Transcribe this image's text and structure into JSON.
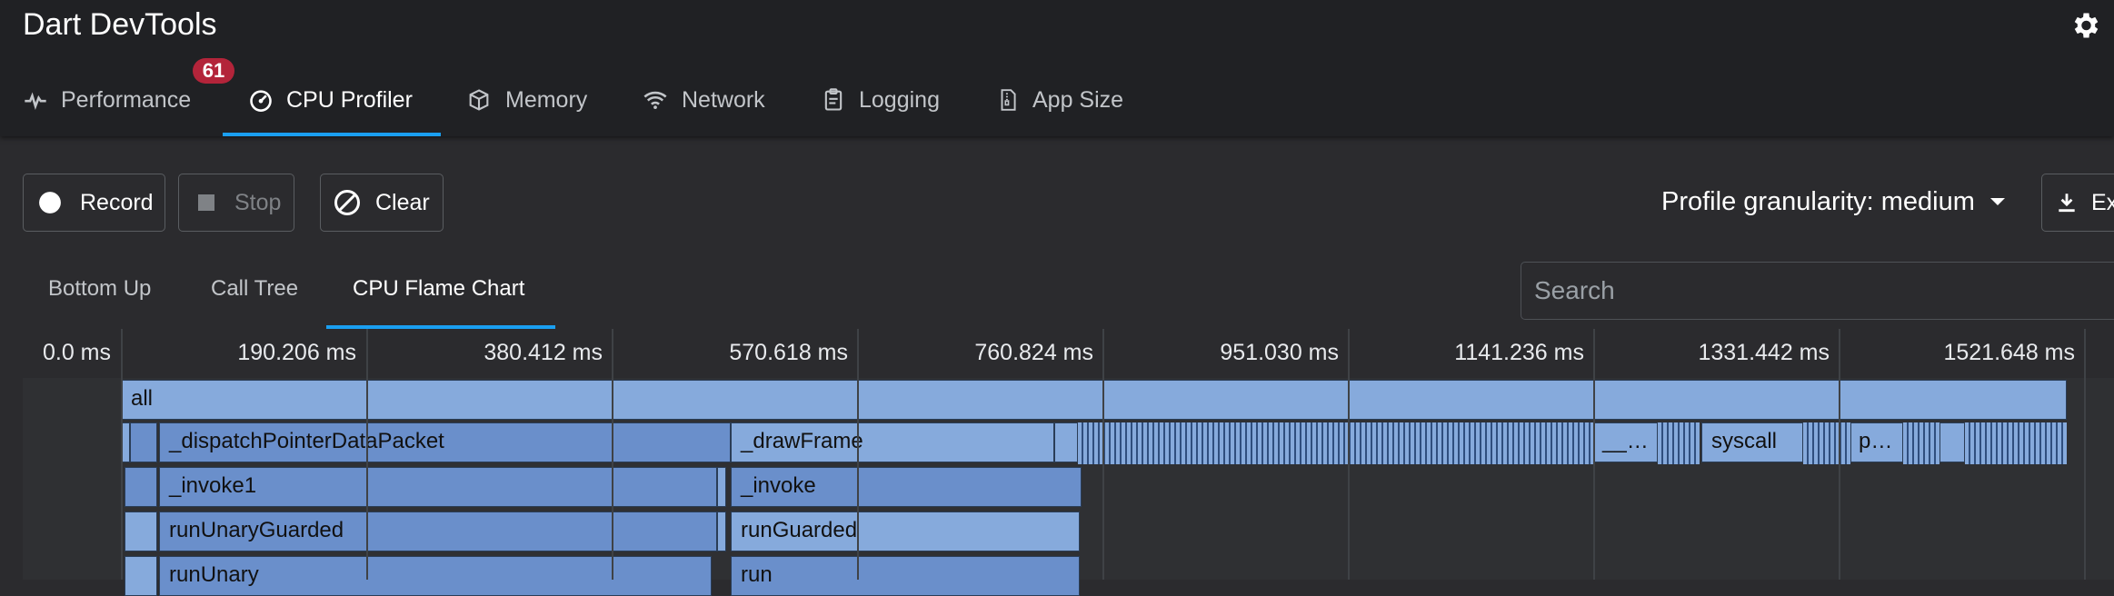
{
  "app": {
    "title": "Dart DevTools"
  },
  "settings": {
    "icon": "gear-icon"
  },
  "tabs": [
    {
      "label": "Performance",
      "icon": "pulse-icon",
      "badge": "61"
    },
    {
      "label": "CPU Profiler",
      "icon": "speedometer-icon",
      "active": true
    },
    {
      "label": "Memory",
      "icon": "cube-icon"
    },
    {
      "label": "Network",
      "icon": "wifi-icon"
    },
    {
      "label": "Logging",
      "icon": "clipboard-icon"
    },
    {
      "label": "App Size",
      "icon": "file-zip-icon"
    }
  ],
  "controls": {
    "record_label": "Record",
    "stop_label": "Stop",
    "clear_label": "Clear",
    "granularity_label": "Profile granularity: medium",
    "export_label": "Export"
  },
  "subtabs": [
    {
      "label": "Bottom Up"
    },
    {
      "label": "Call Tree"
    },
    {
      "label": "CPU Flame Chart",
      "active": true
    }
  ],
  "search": {
    "placeholder": "Search",
    "value": ""
  },
  "timeline": {
    "ticks": [
      "0.0 ms",
      "190.206 ms",
      "380.412 ms",
      "570.618 ms",
      "760.824 ms",
      "951.030 ms",
      "1141.236 ms",
      "1331.442 ms",
      "1521.648 ms"
    ]
  },
  "flame": {
    "row0": {
      "label": "all"
    },
    "row1": {
      "dispatch": "_dispatchPointerDataPacket",
      "draw": "_drawFrame",
      "ellipsis1": "__…",
      "syscall": "syscall",
      "ellipsis2": "p…"
    },
    "row2": {
      "invoke1": "_invoke1",
      "invoke": "_invoke"
    },
    "row3": {
      "run_unary_guarded": "runUnaryGuarded",
      "run_guarded": "runGuarded"
    },
    "row4": {
      "run_unary": "runUnary",
      "run": "run"
    }
  },
  "colors": {
    "accent": "#1a9ff0",
    "badge": "#b3243a",
    "node_light": "#86aadc",
    "node_dark": "#6a8fcb"
  }
}
